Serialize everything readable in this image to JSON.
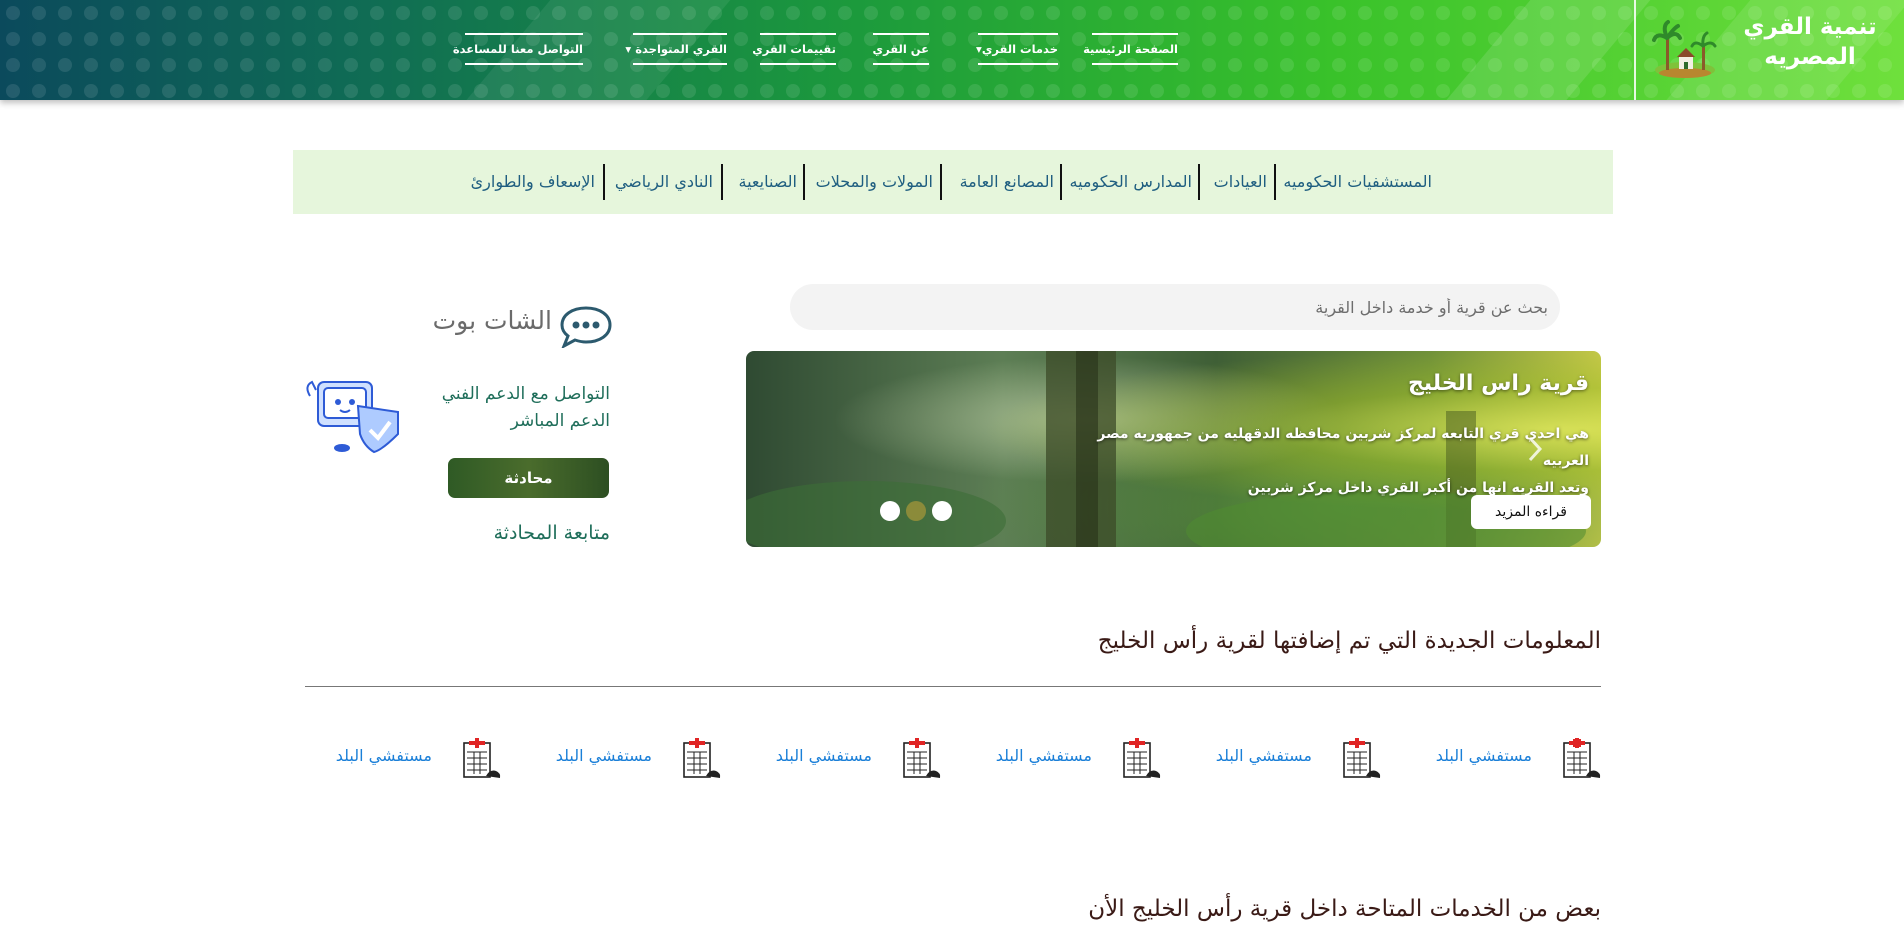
{
  "brand": {
    "line1": "تنمية القري",
    "line2": "المصريه"
  },
  "nav": [
    {
      "label": "الصفحة الرئيسية"
    },
    {
      "label": "خدمات القري"
    },
    {
      "label": "عن القري"
    },
    {
      "label": "تقييمات القري"
    },
    {
      "label": "القري المتواجدة"
    },
    {
      "label": "التواصل معنا للمساعدة"
    }
  ],
  "categories": [
    "المستشفيات الحكوميه",
    "العيادات",
    "المدارس الحكوميه",
    "المصانع العامة",
    "المولات والمحلات",
    "الصنايعية",
    "النادي الرياضي",
    "الإسعاف والطوارئ"
  ],
  "search": {
    "placeholder": "بحث عن قرية أو خدمة داخل القرية"
  },
  "slide": {
    "title": "قرية راس الخليج",
    "line1": "هي احدي قري التابعه لمركز شربين محافظه الدقهليه من جمهوريه مصر العربيه",
    "line2": "وتعد القريه انها من أكبر القري داخل مركز شربين",
    "button": "قراءه المزيد",
    "active_dot": 1
  },
  "chatbot": {
    "title": "الشات بوت",
    "line1": "التواصل مع الدعم الفني",
    "line2": "الدعم المباشر",
    "button": "محادثة",
    "follow": "متابعة المحادثة"
  },
  "new_info": {
    "title": "المعلومات الجديدة التي تم إضافتها لقرية رأس الخليج",
    "items": [
      "مستفشي البلد",
      "مستفشي البلد",
      "مستفشي البلد",
      "مستفشي البلد",
      "مستفشي البلد",
      "مستفشي البلد"
    ]
  },
  "services": {
    "title": "بعض من الخدمات المتاحة داخل قرية رأس الخليج الأن"
  },
  "colors": {
    "accent_green": "#39c22a",
    "link_blue": "#1a7fd8",
    "teal": "#1f6e5a"
  }
}
